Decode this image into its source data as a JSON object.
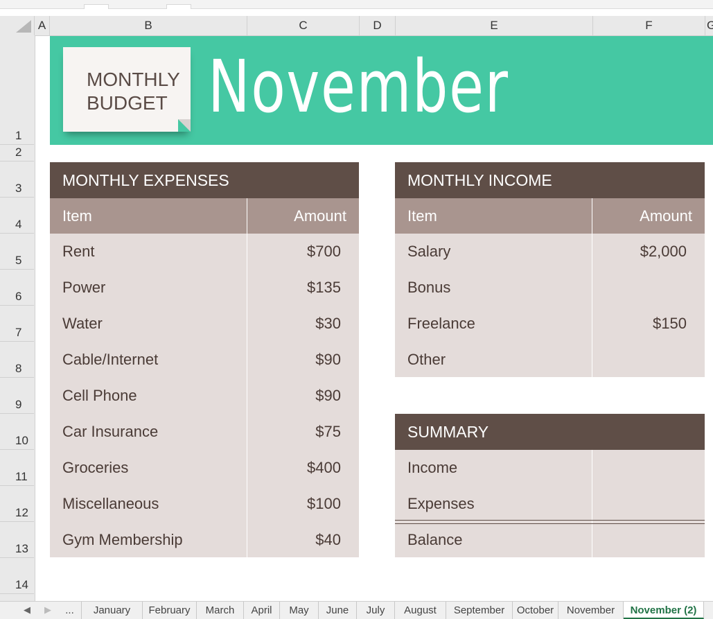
{
  "columns": [
    "A",
    "B",
    "C",
    "D",
    "E",
    "F",
    "G"
  ],
  "rows": [
    "1",
    "2",
    "3",
    "4",
    "5",
    "6",
    "7",
    "8",
    "9",
    "10",
    "11",
    "12",
    "13",
    "14"
  ],
  "banner": {
    "sticky_line1": "MONTHLY",
    "sticky_line2": "BUDGET",
    "month": "November",
    "accent_color": "#45c8a3"
  },
  "expenses": {
    "title": "MONTHLY EXPENSES",
    "col_item": "Item",
    "col_amount": "Amount",
    "rows": [
      {
        "item": "Rent",
        "amount": "$700"
      },
      {
        "item": "Power",
        "amount": "$135"
      },
      {
        "item": "Water",
        "amount": "$30"
      },
      {
        "item": "Cable/Internet",
        "amount": "$90"
      },
      {
        "item": "Cell Phone",
        "amount": "$90"
      },
      {
        "item": "Car Insurance",
        "amount": "$75"
      },
      {
        "item": "Groceries",
        "amount": "$400"
      },
      {
        "item": "Miscellaneous",
        "amount": "$100"
      },
      {
        "item": "Gym Membership",
        "amount": "$40"
      }
    ]
  },
  "income": {
    "title": "MONTHLY INCOME",
    "col_item": "Item",
    "col_amount": "Amount",
    "rows": [
      {
        "item": "Salary",
        "amount": "$2,000"
      },
      {
        "item": "Bonus",
        "amount": ""
      },
      {
        "item": "Freelance",
        "amount": "$150"
      },
      {
        "item": "Other",
        "amount": ""
      }
    ]
  },
  "summary": {
    "title": "SUMMARY",
    "rows": [
      {
        "item": "Income",
        "amount": ""
      },
      {
        "item": "Expenses",
        "amount": ""
      },
      {
        "item": "Balance",
        "amount": ""
      }
    ]
  },
  "sheet_tabs": {
    "ellipsis": "...",
    "tabs": [
      "January",
      "February",
      "March",
      "April",
      "May",
      "June",
      "July",
      "August",
      "September",
      "October",
      "November",
      "November (2)"
    ],
    "active": "November (2)"
  },
  "colors": {
    "table_title": "#5f4e47",
    "table_header": "#a9958f",
    "table_body": "#e4dcda",
    "active_tab": "#217346"
  }
}
